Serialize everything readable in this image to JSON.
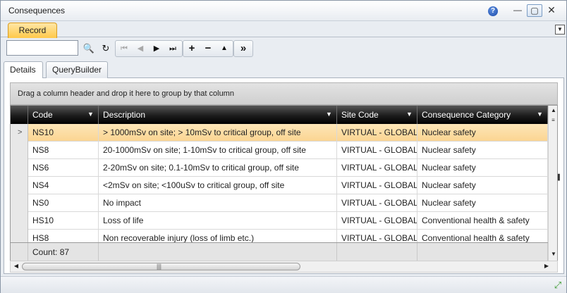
{
  "window": {
    "title": "Consequences",
    "help_icon": "?",
    "minimize_glyph": "—",
    "maximize_glyph": "▢",
    "close_glyph": "✕"
  },
  "tabs": {
    "record_label": "Record",
    "dropdown_glyph": "▼"
  },
  "toolbar": {
    "search_value": "",
    "search_icon": "🔍",
    "refresh_icon": "↻",
    "nav": [
      "⏮",
      "◀",
      "▶",
      "⏭"
    ],
    "edit": [
      "+",
      "−",
      "▲"
    ],
    "more": "»"
  },
  "detail_tabs": [
    "Details",
    "QueryBuilder"
  ],
  "group_panel_text": "Drag a column header and drop it here to group by that column",
  "grid": {
    "columns": [
      "Code",
      "Description",
      "Site Code",
      "Consequence Category"
    ],
    "filter_glyph": "▼",
    "rows": [
      {
        "code": "NS10",
        "description": "> 1000mSv on site; > 10mSv to critical group, off site",
        "site": "VIRTUAL - GLOBAL",
        "category": "Nuclear safety"
      },
      {
        "code": "NS8",
        "description": "20-1000mSv on site; 1-10mSv to critical group, off site",
        "site": "VIRTUAL - GLOBAL",
        "category": "Nuclear safety"
      },
      {
        "code": "NS6",
        "description": "2-20mSv on site; 0.1-10mSv to critical group, off site",
        "site": "VIRTUAL - GLOBAL",
        "category": "Nuclear safety"
      },
      {
        "code": "NS4",
        "description": "<2mSv on site; <100uSv to critical group, off site",
        "site": "VIRTUAL - GLOBAL",
        "category": "Nuclear safety"
      },
      {
        "code": "NS0",
        "description": "No impact",
        "site": "VIRTUAL - GLOBAL",
        "category": "Nuclear safety"
      },
      {
        "code": "HS10",
        "description": "Loss of life",
        "site": "VIRTUAL - GLOBAL",
        "category": "Conventional health & safety"
      },
      {
        "code": "HS8",
        "description": "Non recoverable injury (loss of limb etc.)",
        "site": "VIRTUAL - GLOBAL",
        "category": "Conventional health & safety"
      }
    ],
    "count_label": "Count: 87",
    "selected_indicator": ">"
  }
}
